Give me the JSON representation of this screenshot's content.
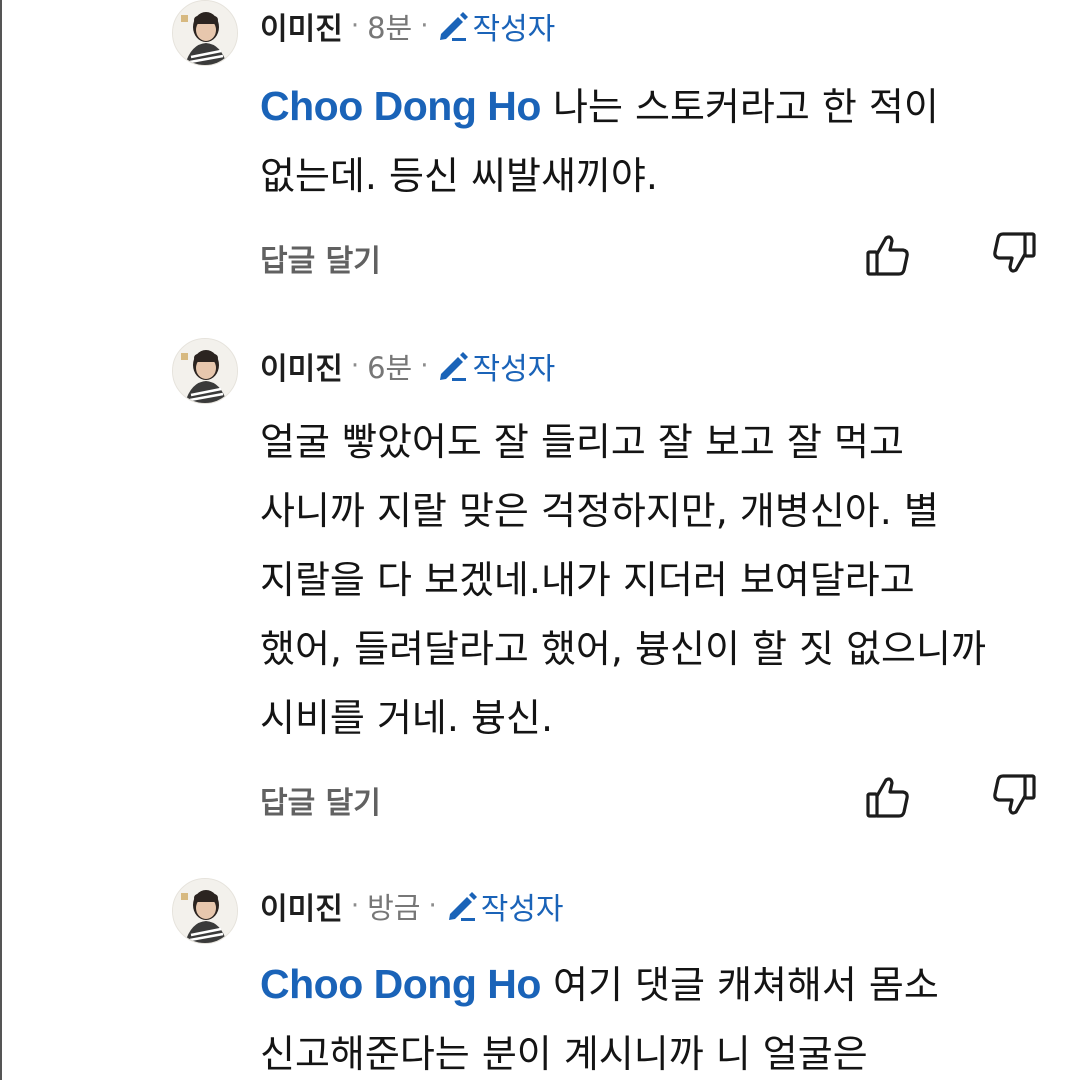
{
  "comments": [
    {
      "author": "이미진",
      "separator": "·",
      "time": "8분",
      "badge": "작성자",
      "mention": "Choo Dong Ho",
      "lines": [
        "나는 스토커라고 한 적이",
        "없는데. 등신 씨발새끼야."
      ],
      "reply_label": "답글 달기"
    },
    {
      "author": "이미진",
      "separator": "·",
      "time": "6분",
      "badge": "작성자",
      "mention": "",
      "lines": [
        "얼굴 빻았어도 잘 들리고 잘 보고 잘 먹고",
        "사니까 지랄 맞은 걱정하지만, 개병신아. 별",
        "지랄을 다 보겠네.내가 지더러 보여달라고",
        "했어, 들려달라고 했어, 븅신이 할 짓 없으니까",
        "시비를 거네. 븅신."
      ],
      "reply_label": "답글 달기"
    },
    {
      "author": "이미진",
      "separator": "·",
      "time": "방금",
      "badge": "작성자",
      "mention": "Choo Dong Ho",
      "lines": [
        "여기 댓글 캐쳐해서 몸소",
        "신고해준다는 분이 계시니까 니 얼굴은"
      ],
      "reply_label": ""
    }
  ],
  "icons": {
    "avatar": "avatar-photo",
    "author_badge": "pencil-icon",
    "like": "thumbs-up-icon",
    "dislike": "thumbs-down-icon"
  },
  "colors": {
    "accent_blue": "#1a63b8",
    "text": "#141414",
    "muted": "#777777",
    "reply": "#616161"
  }
}
